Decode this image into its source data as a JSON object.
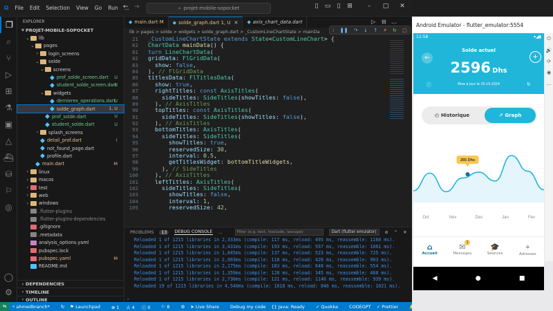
{
  "vscode": {
    "menu": [
      "File",
      "Edit",
      "Selection",
      "View",
      "Go",
      "Run",
      "..."
    ],
    "search_text": "projet-mobile-sopocket",
    "explorer_title": "EXPLORER",
    "project_title": "PROJET-MOBILE-SOPOCKET",
    "tree": [
      {
        "label": "lib",
        "indent": 1,
        "arrow": "v",
        "kind": "folder",
        "color": "#dcb67a"
      },
      {
        "label": "pages",
        "indent": 2,
        "arrow": "v",
        "kind": "folder",
        "color": "#dcb67a"
      },
      {
        "label": "login_screens",
        "indent": 3,
        "arrow": ">",
        "kind": "folder",
        "color": "#dcb67a"
      },
      {
        "label": "solde",
        "indent": 3,
        "arrow": "v",
        "kind": "folder",
        "color": "#dcb67a",
        "badge": "",
        "badge_color": "#73c991"
      },
      {
        "label": "screens",
        "indent": 4,
        "arrow": "v",
        "kind": "folder",
        "color": "#dcb67a"
      },
      {
        "label": "prof_solde_screen.dart",
        "indent": 5,
        "arrow": "",
        "kind": "dart",
        "color": "#4fc3f7",
        "badge": "U",
        "badge_color": "#73c991"
      },
      {
        "label": "student_solde_screen.dart",
        "indent": 5,
        "arrow": "",
        "kind": "dart",
        "color": "#4fc3f7",
        "badge": "U",
        "badge_color": "#73c991"
      },
      {
        "label": "widgets",
        "indent": 4,
        "arrow": "v",
        "kind": "folder",
        "color": "#dcb67a"
      },
      {
        "label": "dernieres_operations.dart",
        "indent": 5,
        "arrow": "",
        "kind": "dart",
        "color": "#4fc3f7",
        "badge": "U",
        "badge_color": "#73c991"
      },
      {
        "label": "solde_graph.dart",
        "indent": 5,
        "arrow": "",
        "kind": "dart",
        "color": "#4fc3f7",
        "badge": "1, U",
        "badge_color": "#e2c08d",
        "selected": true
      },
      {
        "label": "prof_solde.dart",
        "indent": 4,
        "arrow": "",
        "kind": "dart",
        "color": "#4fc3f7",
        "badge": "U",
        "badge_color": "#73c991"
      },
      {
        "label": "student_solde.dart",
        "indent": 4,
        "arrow": "",
        "kind": "dart",
        "color": "#4fc3f7",
        "badge": "U",
        "badge_color": "#73c991"
      },
      {
        "label": "splash_screens",
        "indent": 3,
        "arrow": ">",
        "kind": "folder",
        "color": "#dcb67a"
      },
      {
        "label": "detail_prof.dart",
        "indent": 3,
        "arrow": "",
        "kind": "dart",
        "color": "#4fc3f7",
        "badge": "!",
        "badge_color": "#e2c08d"
      },
      {
        "label": "not_found_page.dart",
        "indent": 3,
        "arrow": "",
        "kind": "dart",
        "color": "#4fc3f7"
      },
      {
        "label": "profile.dart",
        "indent": 3,
        "arrow": "",
        "kind": "dart",
        "color": "#4fc3f7"
      },
      {
        "label": "main.dart",
        "indent": 2,
        "arrow": "",
        "kind": "dart",
        "color": "#4fc3f7",
        "badge": "M",
        "badge_color": "#e2c08d"
      },
      {
        "label": "linux",
        "indent": 1,
        "arrow": ">",
        "kind": "folder",
        "color": "#dcb67a"
      },
      {
        "label": "macos",
        "indent": 1,
        "arrow": ">",
        "kind": "folder",
        "color": "#dcb67a"
      },
      {
        "label": "test",
        "indent": 1,
        "arrow": ">",
        "kind": "folder",
        "color": "#e06c75"
      },
      {
        "label": "web",
        "indent": 1,
        "arrow": ">",
        "kind": "folder",
        "color": "#dcb67a"
      },
      {
        "label": "windows",
        "indent": 1,
        "arrow": ">",
        "kind": "folder",
        "color": "#dcb67a"
      },
      {
        "label": ".flutter-plugins",
        "indent": 1,
        "arrow": "",
        "kind": "file",
        "color": "#858585",
        "dim": true
      },
      {
        "label": ".flutter-plugins-dependencies",
        "indent": 1,
        "arrow": "",
        "kind": "file",
        "color": "#858585",
        "dim": true
      },
      {
        "label": ".gitignore",
        "indent": 1,
        "arrow": "",
        "kind": "file",
        "color": "#e06c75"
      },
      {
        "label": ".metadata",
        "indent": 1,
        "arrow": "",
        "kind": "file",
        "color": "#858585"
      },
      {
        "label": "analysis_options.yaml",
        "indent": 1,
        "arrow": "",
        "kind": "file",
        "color": "#c586c0"
      },
      {
        "label": "pubspec.lock",
        "indent": 1,
        "arrow": "",
        "kind": "file",
        "color": "#e06c75"
      },
      {
        "label": "pubspec.yaml",
        "indent": 1,
        "arrow": "",
        "kind": "file",
        "color": "#e06c75",
        "badge": "M",
        "badge_color": "#e2c08d"
      },
      {
        "label": "README.md",
        "indent": 1,
        "arrow": "",
        "kind": "file",
        "color": "#4fc3f7"
      }
    ],
    "bottom_sections": [
      "DEPENDENCIES",
      "TIMELINE",
      "OUTLINE"
    ],
    "tabs": [
      {
        "label": "main.dart",
        "suffix": "M",
        "active": false
      },
      {
        "label": "solde_graph.dart",
        "suffix": "1, U",
        "active": true
      },
      {
        "label": "axis_chart_data.dart",
        "suffix": "",
        "active": false
      }
    ],
    "breadcrumb": "lib > pages > solde > widgets > solde_graph.dart > _CustomLineChartState > mainDa",
    "code_lines": [
      {
        "n": "21",
        "html": "<span class='kw'>_CustomLineChartState</span> <span class='kw'>extends</span> <span class='ty'>State</span>&lt;<span class='ty'>CustomLineChart</span>&gt; {"
      },
      {
        "n": "62",
        "html": "<span class='ty'>ChartData</span> <span class='fn'>mainData</span>() {"
      },
      {
        "n": "81",
        "html": "<span class='kw'>turn</span> <span class='ty'>LineChartData</span>("
      },
      {
        "n": "82",
        "html": "<span class='pr'>gridData</span>: <span class='ty'>FlGridData</span>("
      },
      {
        "n": "83",
        "html": "  <span class='pr'>show</span>: <span class='bo'>false</span>,"
      },
      {
        "n": "84",
        "html": "), <span class='cm'>// FlGridData</span>"
      },
      {
        "n": "85",
        "html": "<span class='pr'>titlesData</span>: <span class='ty'>FlTitlesData</span>("
      },
      {
        "n": "86",
        "html": "  <span class='pr'>show</span>: <span class='bo'>true</span>,"
      },
      {
        "n": "87",
        "html": "  <span class='pr'>rightTitles</span>: <span class='kw'>const</span> <span class='ty'>AxisTitles</span>("
      },
      {
        "n": "88",
        "html": "    <span class='pr'>sideTitles</span>: <span class='ty'>SideTitles</span>(<span class='pr'>showTitles</span>: <span class='bo'>false</span>),"
      },
      {
        "n": "89",
        "html": "  ), <span class='cm'>// AxisTitles</span>"
      },
      {
        "n": "90",
        "html": "  <span class='pr'>topTitles</span>: <span class='kw'>const</span> <span class='ty'>AxisTitles</span>("
      },
      {
        "n": "91",
        "html": "    <span class='pr'>sideTitles</span>: <span class='ty'>SideTitles</span>(<span class='pr'>showTitles</span>: <span class='bo'>false</span>),"
      },
      {
        "n": "92",
        "html": "  ), <span class='cm'>// AxisTitles</span>"
      },
      {
        "n": "93",
        "html": "  <span class='pr'>bottomTitles</span>: <span class='ty'>AxisTitles</span>("
      },
      {
        "n": "94",
        "html": "    <span class='pr'>sideTitles</span>: <span class='ty'>SideTitles</span>("
      },
      {
        "n": "95",
        "html": "      <span class='pr'>showTitles</span>: <span class='bo'>true</span>,"
      },
      {
        "n": "96",
        "html": "      <span class='pr'>reservedSize</span>: <span class='nu'>30</span>,"
      },
      {
        "n": "97",
        "html": "      <span class='pr'>interval</span>: <span class='nu'>0.5</span>,"
      },
      {
        "n": "98",
        "html": "      <span class='pr'>getTitlesWidget</span>: <span class='fn'>bottomTitleWidgets</span>,"
      },
      {
        "n": "99",
        "html": "    ), <span class='cm'>// SideTitles</span>"
      },
      {
        "n": "100",
        "html": "  ), <span class='cm'>// AxisTitles</span>"
      },
      {
        "n": "101",
        "html": "  <span class='pr'>leftTitles</span>: <span class='ty'>AxisTitles</span>("
      },
      {
        "n": "102",
        "html": "    <span class='pr'>sideTitles</span>: <span class='ty'>SideTitles</span>("
      },
      {
        "n": "103",
        "html": "      <span class='pr'>showTitles</span>: <span class='bo'>false</span>,"
      },
      {
        "n": "104",
        "html": "      <span class='pr'>interval</span>: <span class='nu'>1</span>,"
      },
      {
        "n": "105",
        "html": "      <span class='pr'>reservedSize</span>: <span class='nu'>42</span>,"
      }
    ],
    "panel_tabs": [
      "PROBLEMS",
      "13",
      "DEBUG CONSOLE",
      "..."
    ],
    "filter_placeholder": "Filter (e.g. text, !exclude, \\escape)",
    "debug_target": "Dart (flutter emulator)",
    "log_lines": [
      "Reloaded 1 of 1215 libraries in 2,333ms (compile: 117 ms, reload: 495 ms, reassemble: 1160 ms).",
      "Reloaded 1 of 1215 libraries in 3,431ms (compile: 193 ms, reload: 937 ms, reassemble: 1661 ms).",
      "Reloaded 1 of 1215 libraries in 1,845ms (compile: 137 ms, reload: 523 ms, reassemble: 725 ms).",
      "Reloaded 1 of 1215 libraries in 2,003ms (compile: 118 ms, reload: 426 ms, reassemble: 903 ms).",
      "Reloaded 1 of 1215 libraries in 2,175ms (compile: 183 ms, reload: 648 ms, reassemble: 554 ms).",
      "Reloaded 1 of 1215 libraries in 1,359ms (compile: 128 ms, reload: 345 ms, reassemble: 468 ms).",
      "Reloaded 1 of 1215 libraries in 2,736ms (compile: 121 ms, reload: 1140 ms, reassemble: 939 ms).",
      "Reloaded 19 of 1215 libraries in 4,540ms (compile: 1018 ms, reload: 846 ms, reassemble: 1021 ms)."
    ],
    "status": {
      "branch": "ahmedbranch*",
      "launchpad": "Launchpad",
      "errors": "1",
      "warnings": "4",
      "infos": "0",
      "ports": "8",
      "live_share": "Live Share",
      "debug": "Debug my code",
      "java": "Java: Ready",
      "quokka": "Quokka",
      "codegpt": "CODEGPT",
      "prettier": "Prettier"
    }
  },
  "emulator": {
    "title": "Android Emulator - flutter_emulator:5554",
    "time": "11:58",
    "balance_label": "Solde actuel",
    "balance_value": "2596",
    "balance_unit": "Dhs",
    "update_text": "Mise à jour le 30.10.2024",
    "toggle_history": "Historique",
    "toggle_graph": "Graph",
    "nav": [
      {
        "label": "Accueil",
        "active": true
      },
      {
        "label": "Messages",
        "badge": "1"
      },
      {
        "label": "Séances"
      },
      {
        "label": "Adresses"
      }
    ],
    "colors": {
      "accent": "#1fb6d9",
      "dark": "#1a6c8c",
      "tooltip": "#f9c74f"
    }
  },
  "chart_data": {
    "type": "line",
    "categories": [
      "Oct",
      "Nov",
      "Dec",
      "Jan",
      "Fev"
    ],
    "tooltip_label": "265 Dhs",
    "highlight_category": "Dec",
    "grid": false,
    "x": [
      0,
      0.5,
      1,
      1.5,
      2,
      2.5,
      3,
      3.5,
      4
    ],
    "values": [
      1.2,
      3.0,
      1.1,
      2.5,
      3.1,
      2.2,
      4.8,
      3.2,
      1.3
    ],
    "note_values": "shape read from curve, y-axis unlabeled"
  }
}
